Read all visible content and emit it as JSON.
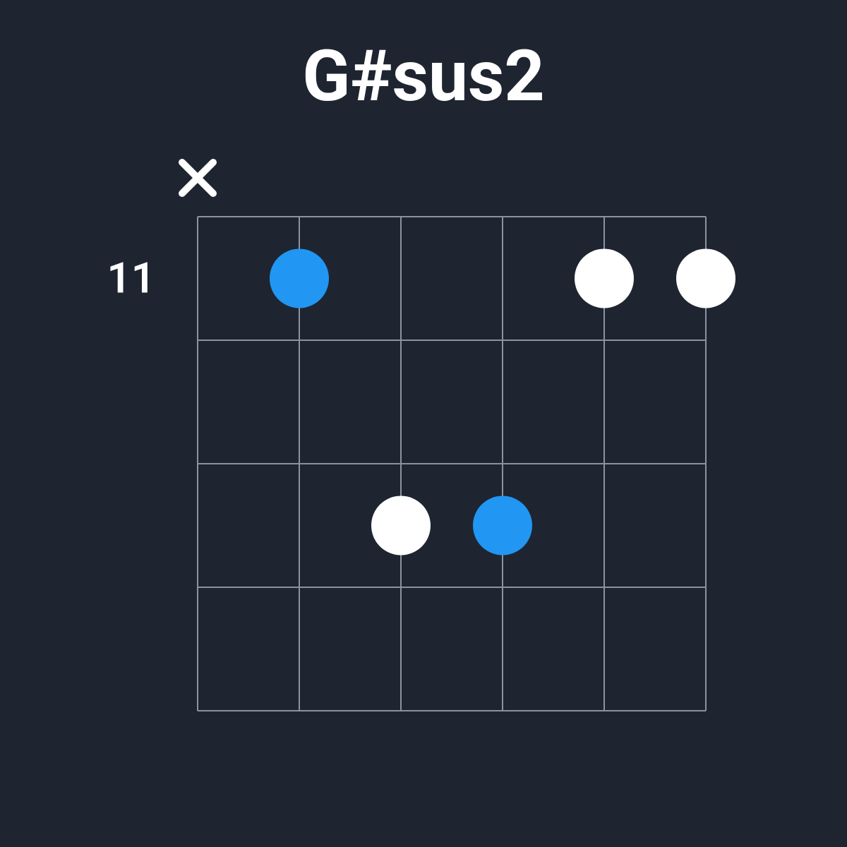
{
  "chord_name": "G#sus2",
  "starting_fret_label": "11",
  "chart_data": {
    "type": "chord-diagram",
    "instrument_strings": 6,
    "frets_shown": 4,
    "starting_fret": 11,
    "colors": {
      "background": "#1e2530",
      "grid": "#8a93a2",
      "root_note": "#2196f3",
      "note": "#ffffff",
      "mute_open": "#ffffff",
      "text": "#ffffff"
    },
    "string_states": [
      {
        "string": 1,
        "state": "muted"
      },
      {
        "string": 2,
        "state": "fretted"
      },
      {
        "string": 3,
        "state": "fretted"
      },
      {
        "string": 4,
        "state": "fretted"
      },
      {
        "string": 5,
        "state": "fretted"
      },
      {
        "string": 6,
        "state": "fretted"
      }
    ],
    "notes": [
      {
        "string": 2,
        "fret": 1,
        "type": "root"
      },
      {
        "string": 3,
        "fret": 3,
        "type": "note"
      },
      {
        "string": 4,
        "fret": 3,
        "type": "root"
      },
      {
        "string": 5,
        "fret": 1,
        "type": "note"
      },
      {
        "string": 6,
        "fret": 1,
        "type": "note"
      }
    ]
  }
}
